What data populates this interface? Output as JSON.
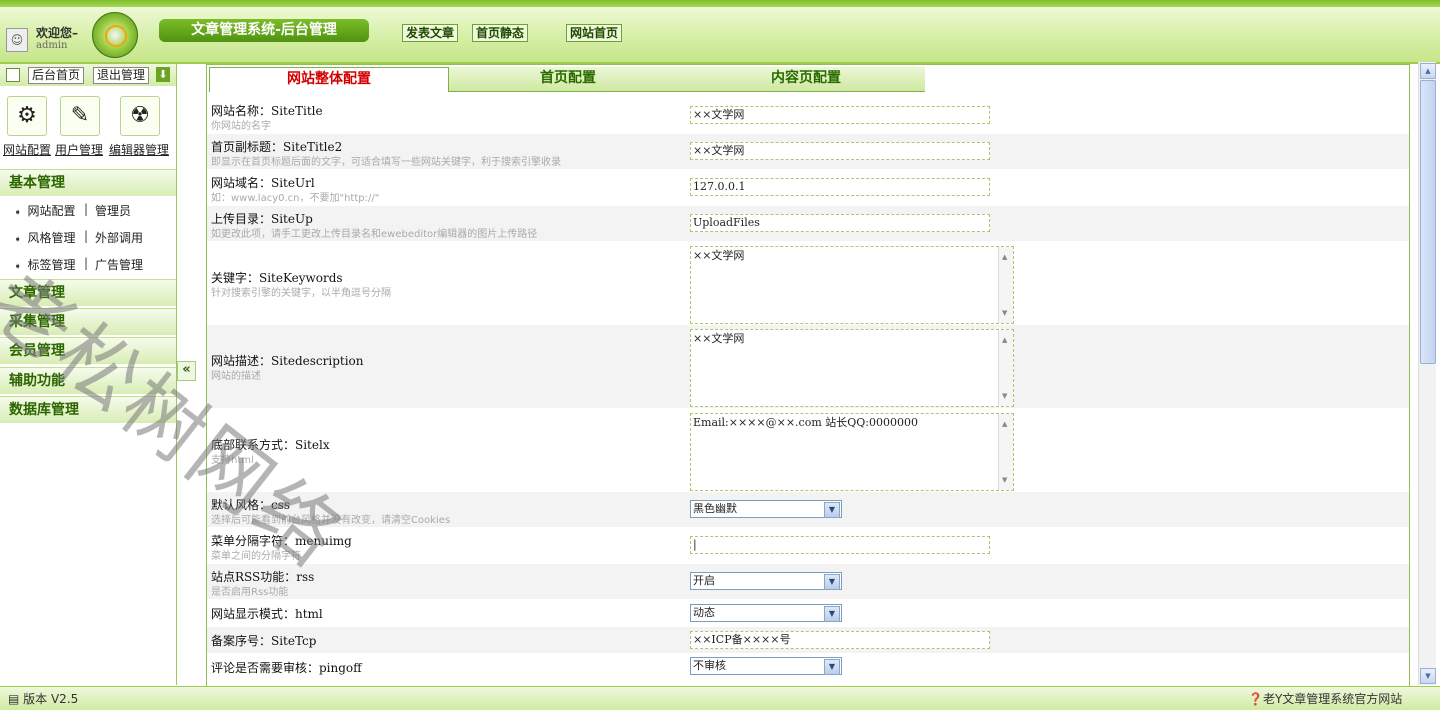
{
  "header": {
    "welcome": "欢迎您–",
    "username": "admin",
    "system_title": "文章管理系统-后台管理",
    "links": [
      "发表文章",
      "首页静态",
      "网站首页"
    ]
  },
  "sidebar": {
    "top_buttons": [
      "后台首页",
      "退出管理"
    ],
    "quick_links": [
      "网站配置",
      "用户管理",
      "编辑器管理"
    ],
    "sections": [
      {
        "title": "基本管理",
        "items": [
          [
            "网站配置",
            "管理员"
          ],
          [
            "风格管理",
            "外部调用"
          ],
          [
            "标签管理",
            "广告管理"
          ]
        ]
      },
      {
        "title": "文章管理"
      },
      {
        "title": "采集管理"
      },
      {
        "title": "会员管理"
      },
      {
        "title": "辅助功能"
      },
      {
        "title": "数据库管理"
      }
    ]
  },
  "tabs": [
    "网站整体配置",
    "首页配置",
    "内容页配置"
  ],
  "fields": [
    {
      "label": "网站名称：SiteTitle",
      "hint": "你网站的名字",
      "value": "××文学网"
    },
    {
      "label": "首页副标题：SiteTitle2",
      "hint": "即显示在首页标题后面的文字，可适合填写一些网站关键字，利于搜索引擎收录",
      "value": "××文学网"
    },
    {
      "label": "网站域名：SiteUrl",
      "hint": "如：www.lacy0.cn，不要加\"http://\"",
      "value": "127.0.0.1"
    },
    {
      "label": "上传目录：SiteUp",
      "hint": "如更改此项，请手工更改上传目录名和ewebeditor编辑器的图片上传路径",
      "value": "UploadFiles"
    },
    {
      "label": "关键字：SiteKeywords",
      "hint": "针对搜索引擎的关键字，以半角逗号分隔",
      "value": "××文学网"
    },
    {
      "label": "网站描述：Sitedescription",
      "hint": "网站的描述",
      "value": "××文学网"
    },
    {
      "label": "底部联系方式：Sitelx",
      "hint": "支持html",
      "value": "Email:××××@××.com 站长QQ:0000000"
    },
    {
      "label": "默认风格：css",
      "hint": "选择后可能看到前台风格并没有改变，请清空Cookies",
      "value": "黑色幽默"
    },
    {
      "label": "菜单分隔字符：menuimg",
      "hint": "菜单之间的分隔字符",
      "value": "|"
    },
    {
      "label": "站点RSS功能：rss",
      "hint": "是否启用Rss功能",
      "value": "开启"
    },
    {
      "label": "网站显示模式：html",
      "hint": "",
      "value": "动态"
    },
    {
      "label": "备案序号：SiteTcp",
      "hint": "",
      "value": "××ICP备××××号"
    },
    {
      "label": "评论是否需要审核：pingoff",
      "hint": "",
      "value": "不审核"
    }
  ],
  "footer": {
    "version": "版本 V2.5",
    "official": "老Y文章管理系统官方网站"
  },
  "watermark": "老松树网络"
}
